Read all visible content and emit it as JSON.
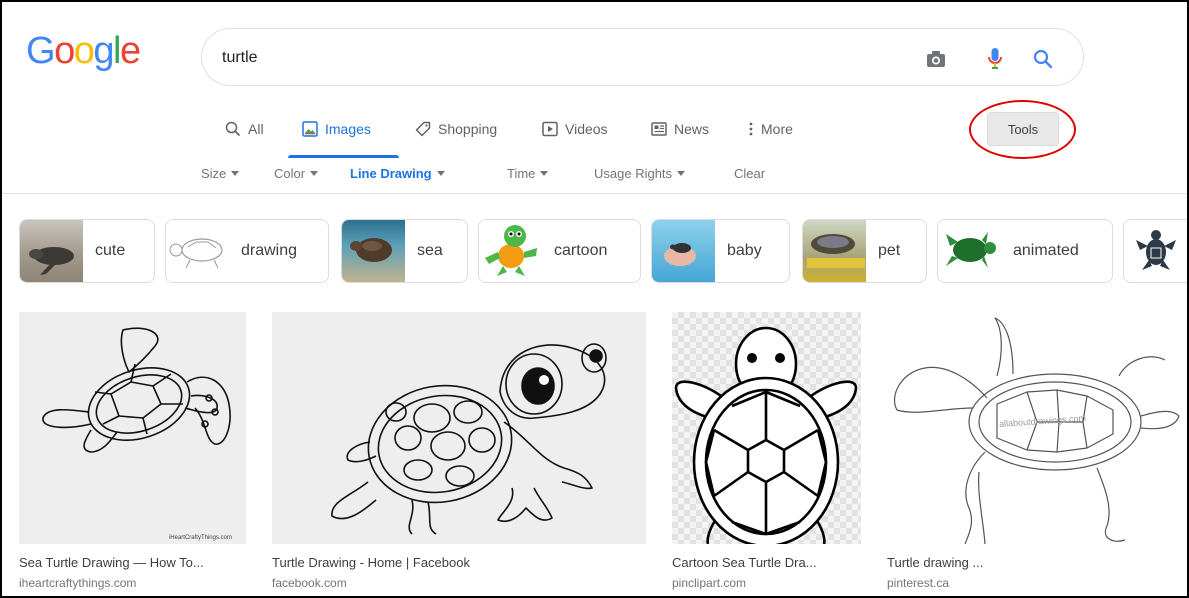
{
  "logo": {
    "letters": [
      "G",
      "o",
      "o",
      "g",
      "l",
      "e"
    ],
    "colors": [
      "#4285f4",
      "#ea4335",
      "#fbbc05",
      "#4285f4",
      "#34a853",
      "#ea4335"
    ]
  },
  "search": {
    "query": "turtle"
  },
  "tabs": [
    {
      "label": "All",
      "icon": "search-icon"
    },
    {
      "label": "Images",
      "icon": "image-icon",
      "active": true
    },
    {
      "label": "Shopping",
      "icon": "tag-icon"
    },
    {
      "label": "Videos",
      "icon": "play-icon"
    },
    {
      "label": "News",
      "icon": "news-icon"
    },
    {
      "label": "More",
      "icon": "more-vert-icon"
    }
  ],
  "tools_label": "Tools",
  "filters": [
    {
      "label": "Size"
    },
    {
      "label": "Color"
    },
    {
      "label": "Line Drawing",
      "active": true
    },
    {
      "label": "Time"
    },
    {
      "label": "Usage Rights"
    },
    {
      "label": "Clear",
      "no_caret": true
    }
  ],
  "chips": [
    {
      "label": "cute"
    },
    {
      "label": "drawing"
    },
    {
      "label": "sea"
    },
    {
      "label": "cartoon"
    },
    {
      "label": "baby"
    },
    {
      "label": "pet"
    },
    {
      "label": "animated"
    }
  ],
  "results": [
    {
      "title": "Sea Turtle Drawing — How To...",
      "site": "iheartcraftythings.com",
      "watermark": "iHeartCraftyThings.com"
    },
    {
      "title": "Turtle Drawing - Home | Facebook",
      "site": "facebook.com"
    },
    {
      "title": "Cartoon Sea Turtle Dra...",
      "site": "pinclipart.com"
    },
    {
      "title": "Turtle drawing ...",
      "site": "pinterest.ca",
      "watermark": "allaboutdrawings.com"
    }
  ],
  "colors": {
    "accent": "#1a73e8",
    "annotation": "#e00000"
  }
}
